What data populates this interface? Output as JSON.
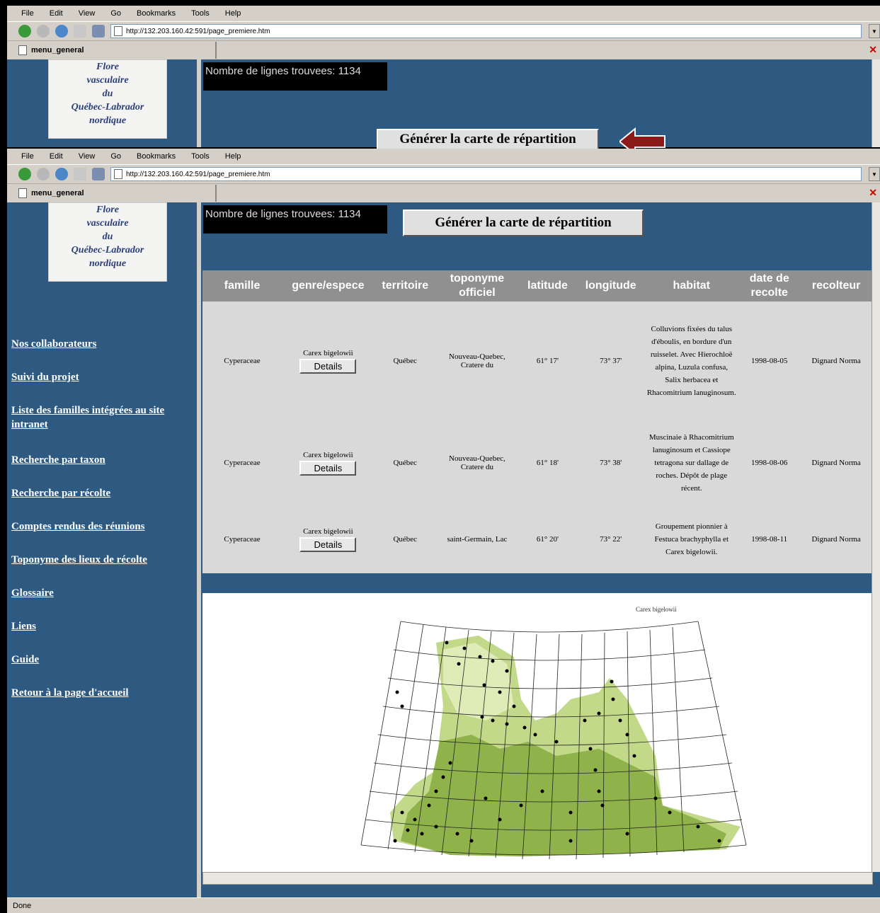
{
  "menu": [
    "File",
    "Edit",
    "View",
    "Go",
    "Bookmarks",
    "Tools",
    "Help"
  ],
  "url": "http://132.203.160.42:591/page_premiere.htm",
  "tab": "menu_general",
  "count_text": "Nombre de lignes trouvees: 1134",
  "generate_button": "Générer la carte de répartition",
  "logo_lines": [
    "Flore",
    "vasculaire",
    "du",
    "Québec-Labrador",
    "nordique"
  ],
  "sidebar_links": [
    "Nos collaborateurs",
    "Suivi du projet",
    "Liste des familles intégrées au site intranet",
    "Recherche par taxon",
    "Recherche par récolte",
    "Comptes rendus des réunions",
    "Toponyme des lieux de récolte",
    "Glossaire",
    "Liens",
    "Guide",
    "Retour à la page d'accueil"
  ],
  "table": {
    "headers": [
      "famille",
      "genre/espece",
      "territoire",
      "toponyme officiel",
      "latitude",
      "longitude",
      "habitat",
      "date de recolte",
      "recolteur"
    ],
    "details_label": "Details",
    "rows": [
      {
        "famille": "Cyperaceae",
        "espece": "Carex bigelowii",
        "territoire": "Québec",
        "toponyme": "Nouveau-Quebec, Cratere du",
        "latitude": "61° 17'",
        "longitude": "73° 37'",
        "habitat": "Colluvions fixées du talus d'éboulis, en bordure d'un ruisselet. Avec Hierochloë alpina, Luzula confusa, Salix herbacea et Rhacomitrium lanuginosum.",
        "date": "1998-08-05",
        "recolteur": "Dignard Norma"
      },
      {
        "famille": "Cyperaceae",
        "espece": "Carex bigelowii",
        "territoire": "Québec",
        "toponyme": "Nouveau-Quebec, Cratere du",
        "latitude": "61° 18'",
        "longitude": "73° 38'",
        "habitat": "Muscinaie à Rhacomitrium lanuginosum et Cassiope tetragona sur dallage de roches. Dépôt de plage récent.",
        "date": "1998-08-06",
        "recolteur": "Dignard Norma"
      },
      {
        "famille": "Cyperaceae",
        "espece": "Carex bigelowii",
        "territoire": "Québec",
        "toponyme": "saint-Germain, Lac",
        "latitude": "61° 20'",
        "longitude": "73° 22'",
        "habitat": "Groupement pionnier à Festuca brachyphylla et Carex bigelowii.",
        "date": "1998-08-11",
        "recolteur": "Dignard Norma"
      }
    ]
  },
  "map_title": "Carex bigelowii",
  "status": "Done",
  "colors": {
    "page_bg": "#2e5a82",
    "header_bg": "#909090",
    "arrow": "#8b1a1a"
  }
}
